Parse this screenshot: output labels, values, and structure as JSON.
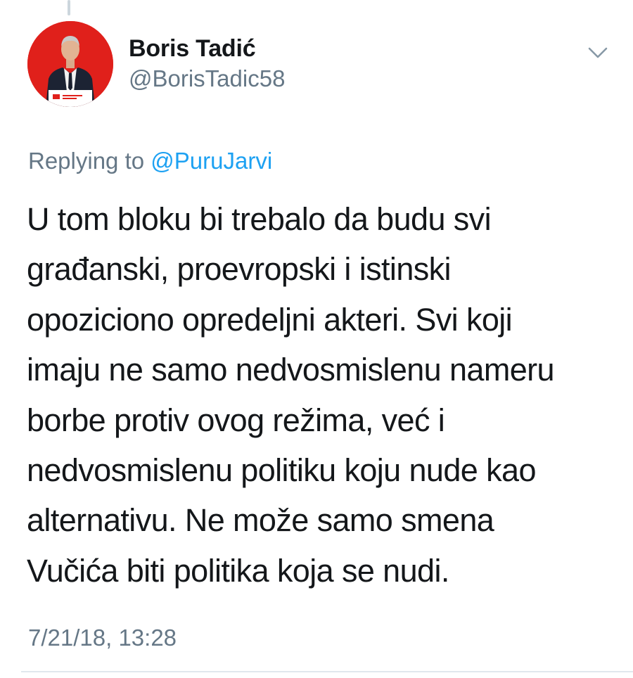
{
  "tweet": {
    "author": {
      "display_name": "Boris Tadić",
      "handle": "@BorisTadic58"
    },
    "reply": {
      "prefix": "Replying to",
      "mention": "@PuruJarvi"
    },
    "text_lines": [
      "U tom bloku bi trebalo da budu svi",
      "građanski, proevropski i istinski",
      "opoziciono opredeljni akteri. Svi koji",
      "imaju ne samo nedvosmislenu nameru",
      "borbe protiv ovog režima, već i",
      "nedvosmislenu politiku koju nude kao",
      "alternativu. Ne može samo smena",
      "Vučića biti politika koja se nudi."
    ],
    "timestamp": "7/21/18, 13:28"
  },
  "icons": {
    "menu": "chevron-down-icon"
  },
  "colors": {
    "text_primary": "#14171a",
    "text_secondary": "#657786",
    "mention": "#1da1f2",
    "avatar_background": "#e0201b",
    "divider": "#e1e8ed"
  }
}
